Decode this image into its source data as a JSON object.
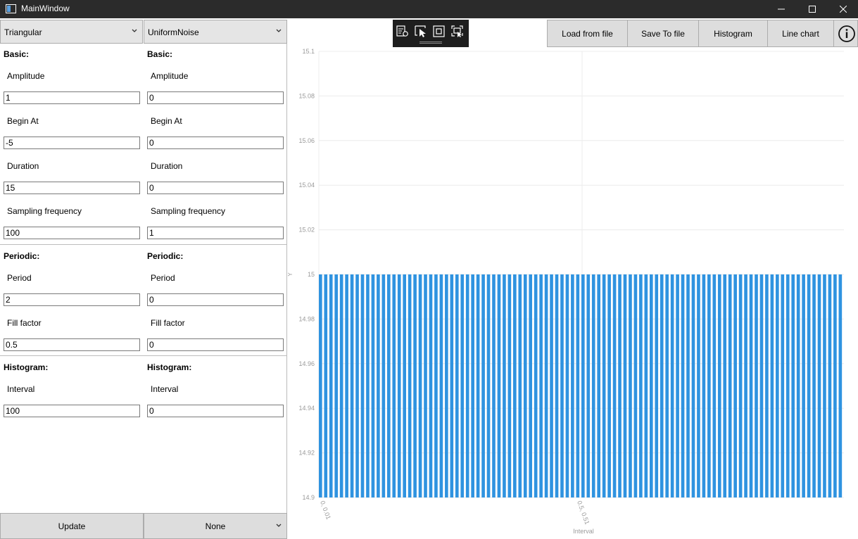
{
  "window": {
    "title": "MainWindow"
  },
  "left_signal": {
    "type": "Triangular",
    "basic_heading": "Basic:",
    "amplitude_label": "Amplitude",
    "amplitude": "1",
    "begin_label": "Begin At",
    "begin": "-5",
    "duration_label": "Duration",
    "duration": "15",
    "sampling_label": "Sampling frequency",
    "sampling": "100",
    "periodic_heading": "Periodic:",
    "period_label": "Period",
    "period": "2",
    "fill_label": "Fill factor",
    "fill": "0.5",
    "histogram_heading": "Histogram:",
    "interval_label": "Interval",
    "interval": "100"
  },
  "right_signal": {
    "type": "UniformNoise",
    "basic_heading": "Basic:",
    "amplitude_label": "Amplitude",
    "amplitude": "0",
    "begin_label": "Begin At",
    "begin": "0",
    "duration_label": "Duration",
    "duration": "0",
    "sampling_label": "Sampling frequency",
    "sampling": "1",
    "periodic_heading": "Periodic:",
    "period_label": "Period",
    "period": "0",
    "fill_label": "Fill factor",
    "fill": "0",
    "histogram_heading": "Histogram:",
    "interval_label": "Interval",
    "interval": "0"
  },
  "bottom": {
    "update_label": "Update",
    "operation": "None"
  },
  "toolbar": {
    "load_label": "Load from file",
    "save_label": "Save To file",
    "histogram_label": "Histogram",
    "linechart_label": "Line chart",
    "icons": [
      "chart-settings-icon",
      "select-cursor-icon",
      "zoom-fit-icon",
      "screenshot-icon",
      "info-icon"
    ]
  },
  "colors": {
    "bar": "#2f93e0",
    "grid": "#ececec",
    "axis_text": "#9a9a9a",
    "titlebar": "#2b2b2b"
  },
  "chart_data": {
    "type": "bar",
    "xlabel": "Interval",
    "ylabel": "Y",
    "ylim": [
      14.9,
      15.1
    ],
    "yticks": [
      "15.1",
      "15.08",
      "15.06",
      "15.04",
      "15.02",
      "15",
      "14.98",
      "14.96",
      "14.94",
      "14.92",
      "14.9"
    ],
    "xtick_labels": [
      "0, 0.01",
      "0.5, 0.51"
    ],
    "bar_count": 100,
    "value": 15,
    "grid": true,
    "legend": "none"
  }
}
